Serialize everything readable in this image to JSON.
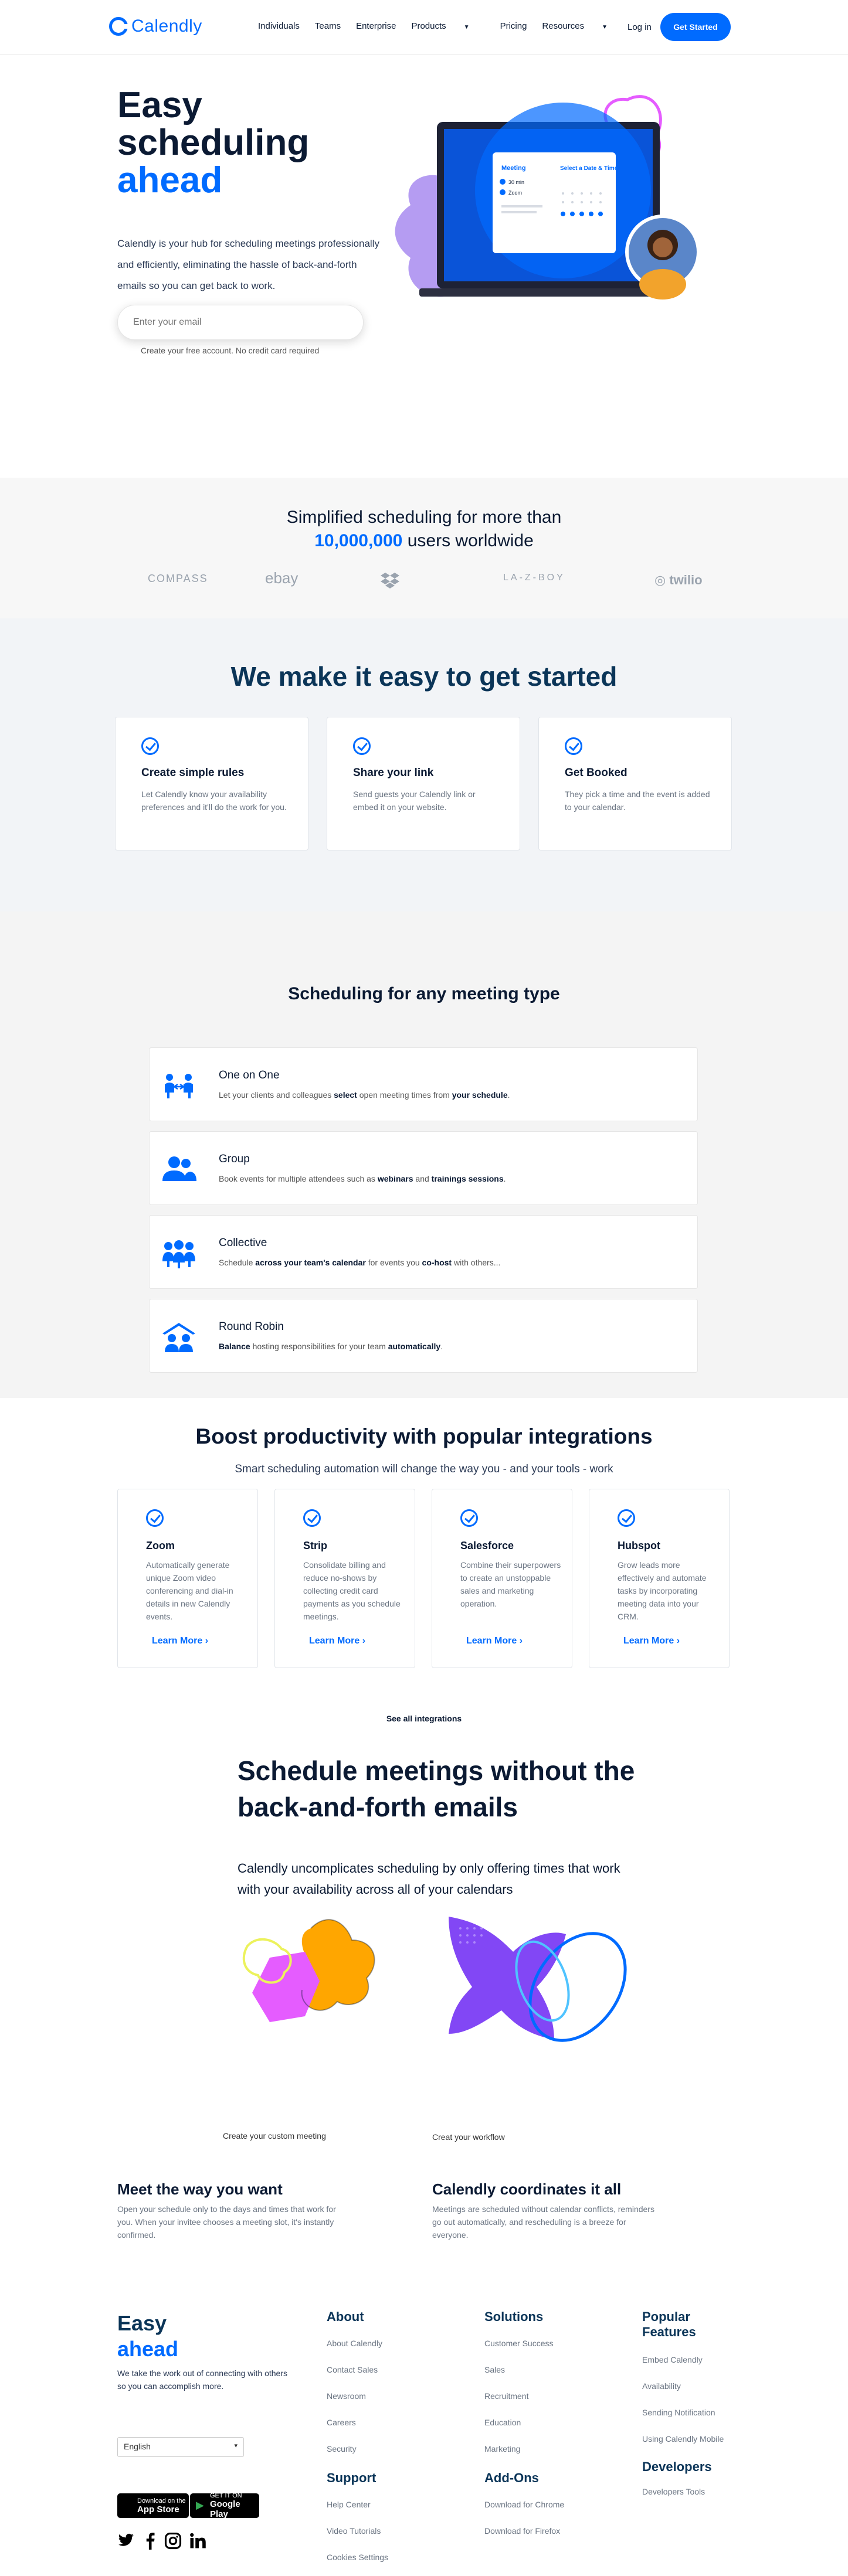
{
  "nav": {
    "logo": "Calendly",
    "items": [
      "Individuals",
      "Teams",
      "Enterprise",
      "Products",
      "Pricing",
      "Resources"
    ],
    "login": "Log in",
    "cta": "Get Started"
  },
  "hero": {
    "title_1": "Easy",
    "title_2": "scheduling",
    "title_3": "ahead",
    "desc": "Calendly is your hub for scheduling meetings professionally and efficiently, eliminating the hassle of back-and-forth emails so you can get back to work.",
    "email_placeholder": "Enter your email",
    "note": "Create your free account. No credit card required",
    "mock": {
      "meeting_label": "Meeting",
      "duration": "30 min",
      "location": "Zoom",
      "select_label": "Select a Date & Time"
    }
  },
  "proof": {
    "line1": "Simplified scheduling for more than",
    "count": "10,000,000",
    "line2_rest": "users worldwide",
    "brands": [
      "COMPASS",
      "ebay",
      "LA-Z-BOY",
      "twilio"
    ]
  },
  "getstarted": {
    "title": "We make it easy to get started",
    "cards": [
      {
        "title": "Create simple rules",
        "desc": "Let Calendly know your availability preferences and it'll do the work for you."
      },
      {
        "title": "Share your link",
        "desc": "Send guests your Calendly link or embed it on your website."
      },
      {
        "title": "Get Booked",
        "desc": "They pick a time and the event is added to your calendar."
      }
    ]
  },
  "types": {
    "title": "Scheduling for any meeting type",
    "items": [
      {
        "title": "One on One",
        "a": "Let your clients and colleagues ",
        "b": "select",
        "c": " open meeting times from ",
        "d": "your schedule",
        "e": "."
      },
      {
        "title": "Group",
        "a": "Book events for multiple attendees such as ",
        "b": "webinars",
        "c": " and ",
        "d": "trainings sessions",
        "e": "."
      },
      {
        "title": "Collective",
        "a": "Schedule ",
        "b": "across your team's calendar",
        "c": " for events you ",
        "d": "co-host",
        "e": " with others..."
      },
      {
        "title": "Round Robin",
        "a": "",
        "b": "Balance",
        "c": " hosting responsibilities for your team ",
        "d": "automatically",
        "e": "."
      }
    ]
  },
  "integrations": {
    "title": "Boost productivity with popular integrations",
    "subtitle": "Smart scheduling automation will change the way you - and your tools - work",
    "learn_more": "Learn More ›",
    "cards": [
      {
        "title": "Zoom",
        "desc": "Automatically generate unique Zoom video conferencing and dial-in details in new Calendly events."
      },
      {
        "title": "Strip",
        "desc": "Consolidate billing and reduce no-shows by collecting credit card payments as you schedule meetings."
      },
      {
        "title": "Salesforce",
        "desc": "Combine their superpowers to create an unstoppable sales and marketing operation."
      },
      {
        "title": "Hubspot",
        "desc": "Grow leads more effectively and automate tasks by incorporating meeting data into your CRM."
      }
    ],
    "see_all": "See all integrations"
  },
  "schedule": {
    "title": "Schedule meetings without the back-and-forth emails",
    "subtitle": "Calendly uncomplicates scheduling by only offering times that work with your availability across all of your calendars",
    "caption_left": "Create your custom meeting",
    "caption_right": "Creat your workflow",
    "features": [
      {
        "title": "Meet the way you want",
        "desc": "Open your schedule only to the days and times that work for you. When your invitee chooses a meeting slot, it's instantly confirmed."
      },
      {
        "title": "Calendly coordinates it all",
        "desc": "Meetings are scheduled without calendar conflicts, reminders go out automatically, and rescheduling is a breeze for everyone."
      }
    ]
  },
  "footer": {
    "brand_1": "Easy",
    "brand_2": "ahead",
    "desc": "We take the work out of connecting with others so you can accomplish more.",
    "language": "English",
    "app_store_small": "Download on the",
    "app_store": "App Store",
    "google_small": "GET IT ON",
    "google": "Google Play",
    "about": {
      "title": "About",
      "links": [
        "About Calendly",
        "Contact Sales",
        "Newsroom",
        "Careers",
        "Security"
      ]
    },
    "support": {
      "title": "Support",
      "links": [
        "Help Center",
        "Video Tutorials",
        "Cookies Settings"
      ]
    },
    "solutions": {
      "title": "Solutions",
      "links": [
        "Customer Success",
        "Sales",
        "Recruitment",
        "Education",
        "Marketing"
      ]
    },
    "addons": {
      "title": "Add-Ons",
      "links": [
        "Download for Chrome",
        "Download for Firefox"
      ]
    },
    "popular": {
      "title_1": "Popular",
      "title_2": "Features",
      "links": [
        "Embed Calendly",
        "Availability",
        "Sending Notification",
        "Using Calendly Mobile"
      ]
    },
    "developers": {
      "title": "Developers",
      "links": [
        "Developers Tools"
      ]
    }
  },
  "colors": {
    "accent": "#006bff",
    "navy": "#0b3558",
    "purple": "#8247f5",
    "pink": "#e55cff",
    "orange": "#ffa600"
  }
}
